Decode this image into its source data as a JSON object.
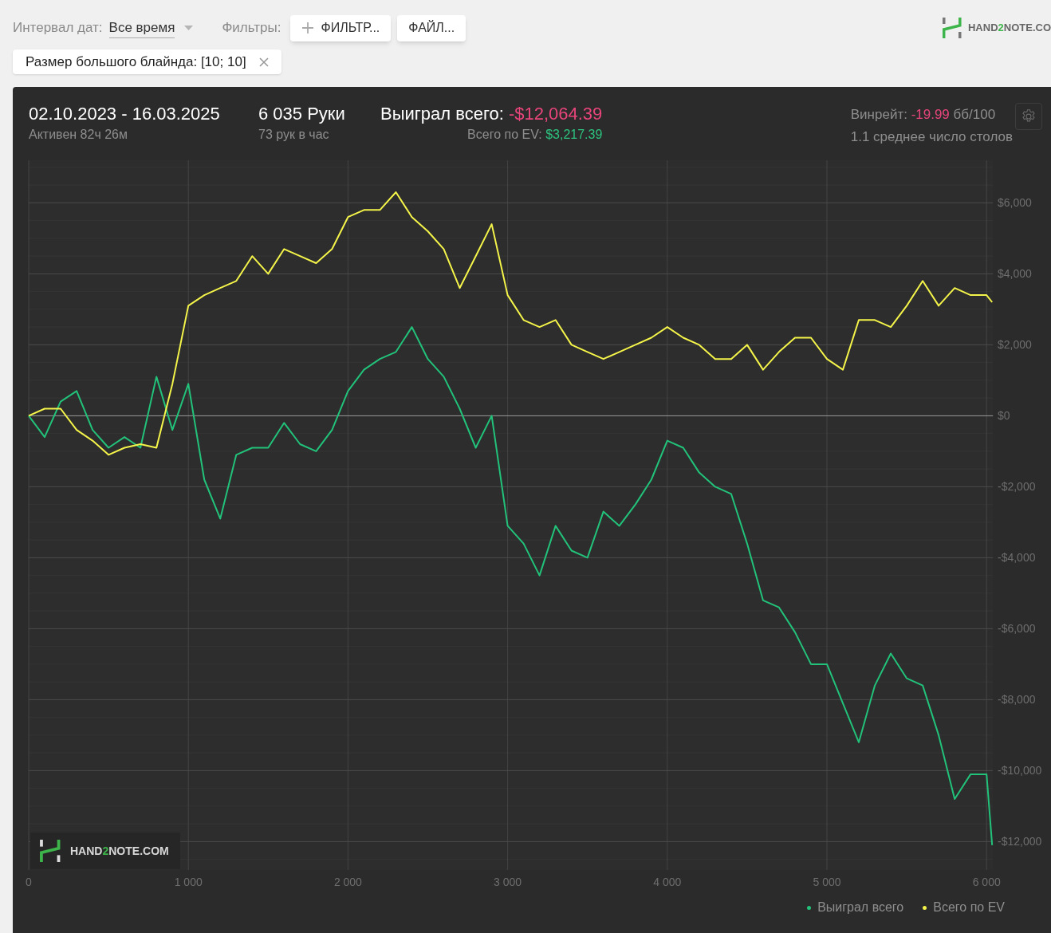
{
  "toolbar": {
    "date_label": "Интервал дат:",
    "date_value": "Все время",
    "filters_label": "Фильтры:",
    "buttons": [
      {
        "kind": "add",
        "label": "ФИЛЬТР..."
      },
      {
        "kind": "plain",
        "label": "ФАЙЛ..."
      }
    ]
  },
  "filter_chip": {
    "label": "Размер большого блайнда: [10; 10]"
  },
  "logo": {
    "prefix": "HAND",
    "accent": "2",
    "suffix": "NOTE.CO"
  },
  "summary": {
    "date_range": "02.10.2023 - 16.03.2025",
    "active": "Активен 82ч 26м",
    "hands": "6 035 Руки",
    "hands_per_hour": "73 рук в час",
    "won_label": "Выиграл всего:",
    "won_value": "-$12,064.39",
    "ev_label": "Всего по EV:",
    "ev_value": "$3,217.39",
    "winrate_label": "Винрейт:",
    "winrate_value": "-19.99",
    "winrate_unit": "бб/100",
    "avg_tables": "1.1 среднее число столов"
  },
  "chart": {
    "watermark": {
      "prefix": "HAND",
      "accent": "2",
      "suffix": "NOTE.COM"
    },
    "chart_data": {
      "type": "line",
      "x": [
        0,
        100,
        200,
        300,
        400,
        500,
        600,
        700,
        800,
        900,
        1000,
        1100,
        1200,
        1300,
        1400,
        1500,
        1600,
        1700,
        1800,
        1900,
        2000,
        2100,
        2200,
        2300,
        2400,
        2500,
        2600,
        2700,
        2800,
        2900,
        3000,
        3100,
        3200,
        3300,
        3400,
        3500,
        3600,
        3700,
        3800,
        3900,
        4000,
        4100,
        4200,
        4300,
        4400,
        4500,
        4600,
        4700,
        4800,
        4900,
        5000,
        5100,
        5200,
        5300,
        5400,
        5500,
        5600,
        5700,
        5800,
        5900,
        6000,
        6035
      ],
      "series": [
        {
          "name": "Выиграл всего",
          "color": "#22c27a",
          "values": [
            0,
            -600,
            400,
            700,
            -400,
            -900,
            -600,
            -900,
            1100,
            -400,
            900,
            -1800,
            -2900,
            -1100,
            -900,
            -900,
            -200,
            -800,
            -1000,
            -400,
            700,
            1300,
            1600,
            1800,
            2500,
            1600,
            1100,
            200,
            -900,
            0,
            -3100,
            -3600,
            -4500,
            -3100,
            -3800,
            -4000,
            -2700,
            -3100,
            -2500,
            -1800,
            -700,
            -900,
            -1600,
            -2000,
            -2200,
            -3600,
            -5200,
            -5400,
            -6100,
            -7000,
            -7000,
            -8100,
            -9200,
            -7600,
            -6700,
            -7400,
            -7600,
            -9000,
            -10800,
            -10100,
            -10100,
            -12100
          ]
        },
        {
          "name": "Всего по EV",
          "color": "#f4f44a",
          "values": [
            0,
            200,
            200,
            -400,
            -700,
            -1100,
            -900,
            -800,
            -900,
            900,
            3100,
            3400,
            3600,
            3800,
            4500,
            4000,
            4700,
            4500,
            4300,
            4700,
            5600,
            5800,
            5800,
            6300,
            5600,
            5200,
            4700,
            3600,
            4500,
            5400,
            3400,
            2700,
            2500,
            2700,
            2000,
            1800,
            1600,
            1800,
            2000,
            2200,
            2500,
            2200,
            2000,
            1600,
            1600,
            2000,
            1300,
            1800,
            2200,
            2200,
            1600,
            1300,
            2700,
            2700,
            2500,
            3100,
            3800,
            3100,
            3600,
            3400,
            3400,
            3200
          ]
        }
      ],
      "grid": true,
      "xlim": [
        0,
        6040
      ],
      "ylim": [
        -12800,
        7200
      ],
      "xticks": [
        {
          "value": 0,
          "label": "0"
        },
        {
          "value": 1000,
          "label": "1 000"
        },
        {
          "value": 2000,
          "label": "2 000"
        },
        {
          "value": 3000,
          "label": "3 000"
        },
        {
          "value": 4000,
          "label": "4 000"
        },
        {
          "value": 5000,
          "label": "5 000"
        },
        {
          "value": 6000,
          "label": "6 000"
        }
      ],
      "yticks": [
        {
          "value": 6000,
          "label": "$6,000"
        },
        {
          "value": 4000,
          "label": "$4,000"
        },
        {
          "value": 2000,
          "label": "$2,000"
        },
        {
          "value": 0,
          "label": "$0"
        },
        {
          "value": -2000,
          "label": "-$2,000"
        },
        {
          "value": -4000,
          "label": "-$4,000"
        },
        {
          "value": -6000,
          "label": "-$6,000"
        },
        {
          "value": -8000,
          "label": "-$8,000"
        },
        {
          "value": -10000,
          "label": "-$10,000"
        },
        {
          "value": -12000,
          "label": "-$12,000"
        }
      ]
    }
  }
}
